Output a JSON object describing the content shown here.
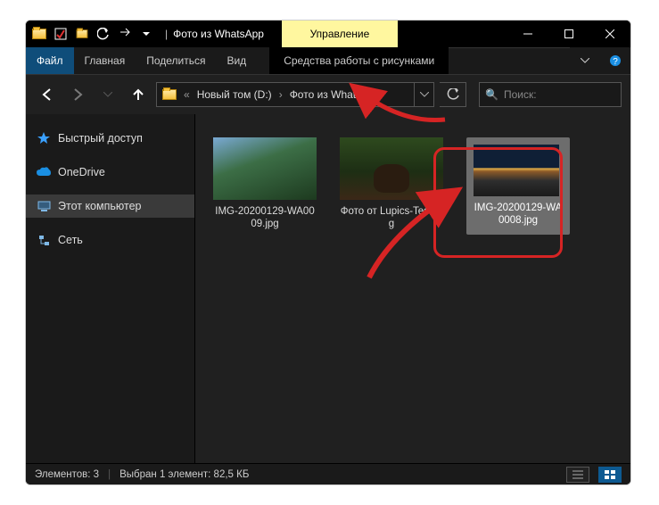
{
  "title": {
    "window_folder": "Фото из WhatsApp",
    "ribbon_context_header": "Управление"
  },
  "ribbon": {
    "file": "Файл",
    "home": "Главная",
    "share": "Поделиться",
    "view": "Вид",
    "picture_tools": "Средства работы с рисунками"
  },
  "nav": {
    "back_icon": "←",
    "forward_icon": "→",
    "up_icon": "↑"
  },
  "address": {
    "prefix": "«",
    "seg1": "Новый том (D:)",
    "seg2": "Фото из WhatsApp",
    "sep": "›"
  },
  "search": {
    "placeholder": "Поиск:",
    "icon": "🔍"
  },
  "sidebar": {
    "items": [
      {
        "label": "Быстрый доступ",
        "icon": "star",
        "color": "#3aa0ff"
      },
      {
        "label": "OneDrive",
        "icon": "cloud",
        "color": "#1a8fe3"
      },
      {
        "label": "Этот компьютер",
        "icon": "pc",
        "color": "#7fb8e6",
        "selected": true
      },
      {
        "label": "Сеть",
        "icon": "net",
        "color": "#7fb8e6"
      }
    ]
  },
  "files": [
    {
      "name": "IMG-20200129-WA0009.jpg",
      "thumb": "river"
    },
    {
      "name": "Фото от Lupics-Test.jpg",
      "thumb": "bear"
    },
    {
      "name": "IMG-20200129-WA0008.jpg",
      "thumb": "road",
      "selected": true
    }
  ],
  "status": {
    "count_label": "Элементов: 3",
    "selection_label": "Выбран 1 элемент: 82,5 КБ"
  },
  "colors": {
    "context_bg": "#fff79f",
    "file_tab_bg": "#0f4d7a",
    "annotation": "#d62424"
  }
}
